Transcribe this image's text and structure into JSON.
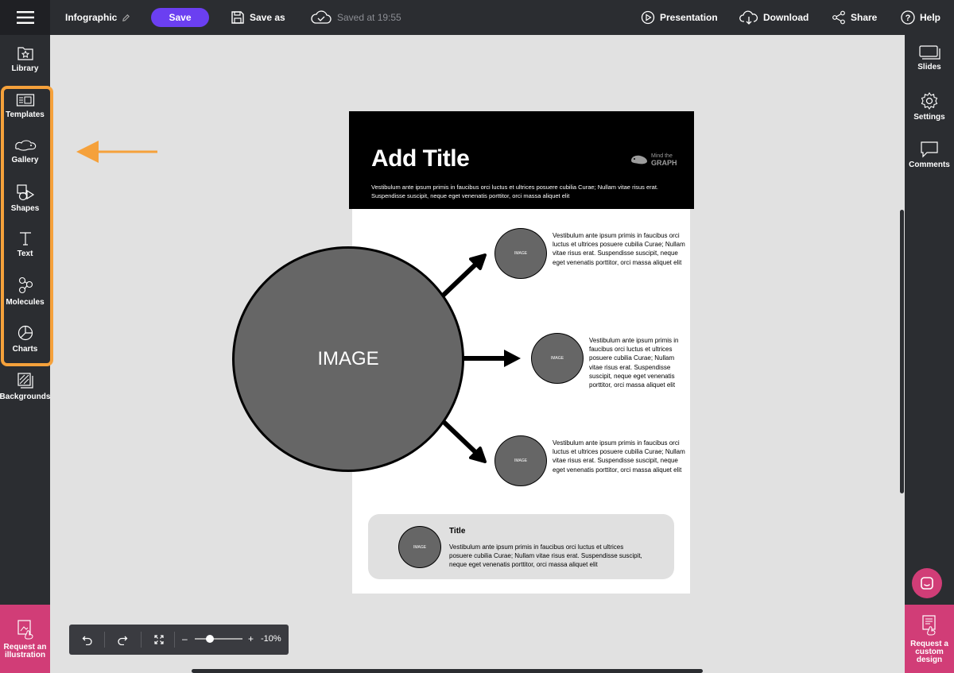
{
  "topbar": {
    "doc_title": "Infographic",
    "save_label": "Save",
    "save_as_label": "Save as",
    "saved_status": "Saved at 19:55",
    "presentation_label": "Presentation",
    "download_label": "Download",
    "share_label": "Share",
    "help_label": "Help"
  },
  "left_sidebar": {
    "items": [
      {
        "label": "Library",
        "icon": "library-icon"
      },
      {
        "label": "Templates",
        "icon": "templates-icon"
      },
      {
        "label": "Gallery",
        "icon": "gallery-icon"
      },
      {
        "label": "Shapes",
        "icon": "shapes-icon"
      },
      {
        "label": "Text",
        "icon": "text-icon"
      },
      {
        "label": "Molecules",
        "icon": "molecules-icon"
      },
      {
        "label": "Charts",
        "icon": "charts-icon"
      },
      {
        "label": "Backgrounds",
        "icon": "backgrounds-icon"
      }
    ],
    "request_illustration": "Request an illustration"
  },
  "right_sidebar": {
    "items": [
      {
        "label": "Slides",
        "icon": "slides-icon"
      },
      {
        "label": "Settings",
        "icon": "gear-icon"
      },
      {
        "label": "Comments",
        "icon": "comment-icon"
      }
    ],
    "request_custom": "Request a custom design"
  },
  "canvas": {
    "title": "Add Title",
    "subtitle": "Vestibulum ante ipsum primis in faucibus orci luctus et ultrices posuere cubilia Curae; Nullam vitae risus erat. Suspendisse suscipit, neque eget venenatis porttitor, orci massa aliquet elit",
    "logo_line1": "Mind the",
    "logo_line2": "GRAPH",
    "main_image_label": "IMAGE",
    "small_image_label": "IMAGE",
    "branches": [
      {
        "text": "Vestibulum ante ipsum primis in faucibus orci luctus et ultrices posuere cubilia Curae; Nullam vitae risus erat. Suspendisse suscipit, neque eget venenatis porttitor, orci massa aliquet elit"
      },
      {
        "text": "Vestibulum ante ipsum primis in faucibus orci luctus et ultrices posuere cubilia Curae; Nullam vitae risus erat. Suspendisse suscipit, neque eget venenatis porttitor, orci massa aliquet elit"
      },
      {
        "text": "Vestibulum ante ipsum primis in faucibus orci luctus et ultrices posuere cubilia Curae; Nullam vitae risus erat. Suspendisse suscipit, neque eget venenatis porttitor, orci massa aliquet elit"
      }
    ],
    "card": {
      "title": "Title",
      "text": "Vestibulum ante ipsum primis in faucibus orci luctus et ultrices posuere cubilia Curae; Nullam vitae risus erat. Suspendisse suscipit, neque eget venenatis porttitor, orci massa aliquet elit",
      "image_label": "IMAGE"
    }
  },
  "zoom": {
    "minus": "–",
    "plus": "+",
    "value": "-10%"
  },
  "colors": {
    "accent_purple": "#6b3ff1",
    "highlight_orange": "#f5a13b",
    "pink": "#d13d77",
    "dark_ui": "#2b2d31"
  }
}
